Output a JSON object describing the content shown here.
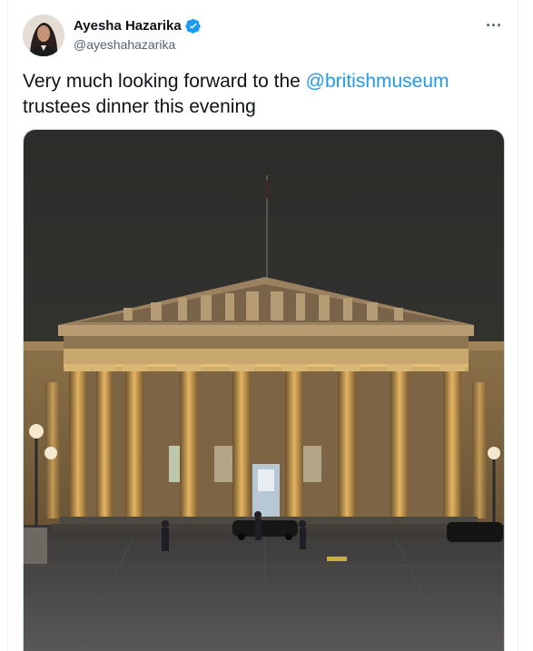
{
  "author": {
    "display_name": "Ayesha Hazarika",
    "handle": "@ayeshahazarika",
    "verified": true,
    "avatar_icon": "profile-photo"
  },
  "tweet": {
    "text_before": "Very much looking forward to the ",
    "mention": "@britishmuseum",
    "text_after": "trustees dinner this evening"
  },
  "more_icon": "ellipsis-icon",
  "colors": {
    "link": "#1d9bf0",
    "verified_badge": "#1d9bf0",
    "text": "#0f1419",
    "secondary": "#536471",
    "sky": "#2b2c29",
    "stone_lit": "#c89a52",
    "pavement": "#4a4847"
  },
  "photo": {
    "subject": "British Museum facade at night"
  }
}
